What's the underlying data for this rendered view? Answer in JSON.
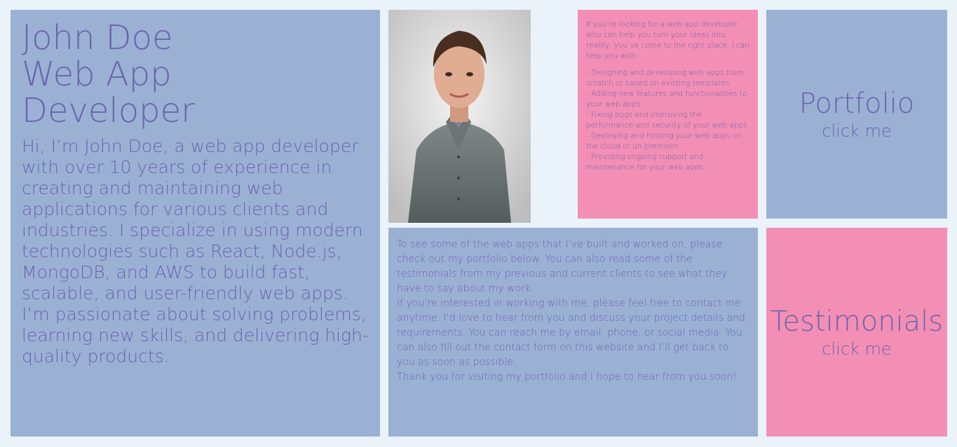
{
  "colors": {
    "background": "#eaf3fa",
    "tile_blue": "#9bb1d4",
    "tile_pink": "#f38fb4",
    "text": "#6a64ae"
  },
  "intro": {
    "title_lines": [
      "John Doe",
      "Web App",
      "Developer"
    ],
    "bio": "Hi, I’m John Doe, a web app developer with over 10 years of experience in creating and maintaining web applications for various clients and industries. I specialize in using modern technologies such as React, Node.js, MongoDB, and AWS to build fast, scalable, and user-friendly web apps. I’m passionate about solving problems, learning new skills, and delivering high-quality products."
  },
  "services": {
    "lead": "If you’re looking for a web app developer who can help you turn your ideas into reality, you’ve come to the right place. I can help you with:",
    "items": [
      "- Designing and developing web apps from scratch or based on existing templates",
      "- Adding new features and functionalities to your web apps",
      "- Fixing bugs and improving the performance and security of your web apps",
      "- Deploying and hosting your web apps on the cloud or on-premises",
      "- Providing ongoing support and maintenance for your web apps"
    ]
  },
  "portfolio": {
    "title": "Portfolio",
    "subtitle": "click me"
  },
  "testimonials": {
    "title": "Testimonials",
    "subtitle": "click me"
  },
  "contact": {
    "paragraphs": [
      "To see some of the web apps that I’ve built and worked on, please check out my portfolio below. You can also read some of the testimonials from my previous and current clients to see what they have to say about my work.",
      "If you’re interested in working with me, please feel free to contact me anytime. I’d love to hear from you and discuss your project details and requirements. You can reach me by email, phone, or social media. You can also fill out the contact form on this website and I’ll get back to you as soon as possible.",
      "Thank you for visiting my portfolio and I hope to hear from you soon!"
    ]
  }
}
